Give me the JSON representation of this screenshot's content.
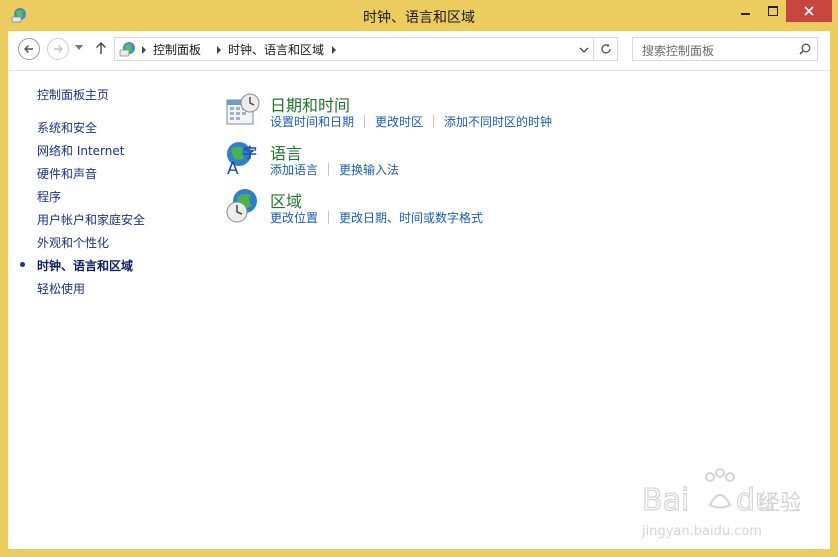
{
  "window": {
    "title": "时钟、语言和区域"
  },
  "navigation": {
    "breadcrumbs": [
      "控制面板",
      "时钟、语言和区域"
    ],
    "search_placeholder": "搜索控制面板"
  },
  "sidebar": {
    "home": "控制面板主页",
    "items": [
      {
        "label": "系统和安全",
        "active": false
      },
      {
        "label": "网络和 Internet",
        "active": false
      },
      {
        "label": "硬件和声音",
        "active": false
      },
      {
        "label": "程序",
        "active": false
      },
      {
        "label": "用户帐户和家庭安全",
        "active": false
      },
      {
        "label": "外观和个性化",
        "active": false
      },
      {
        "label": "时钟、语言和区域",
        "active": true
      },
      {
        "label": "轻松使用",
        "active": false
      }
    ]
  },
  "categories": [
    {
      "title": "日期和时间",
      "icon": "calendar-clock-icon",
      "links": [
        "设置时间和日期",
        "更改时区",
        "添加不同时区的时钟"
      ]
    },
    {
      "title": "语言",
      "icon": "language-globe-icon",
      "links": [
        "添加语言",
        "更换输入法"
      ]
    },
    {
      "title": "区域",
      "icon": "region-globe-clock-icon",
      "links": [
        "更改位置",
        "更改日期、时间或数字格式"
      ]
    }
  ],
  "colors": {
    "frame": "#eccc5e",
    "close_button": "#c7463d",
    "link": "#1a5fb4",
    "category_title": "#1e7a2a",
    "sidebar_link": "#1e3287"
  },
  "watermark": {
    "brand": "Baidu经验",
    "url": "jingyan.baidu.com"
  }
}
